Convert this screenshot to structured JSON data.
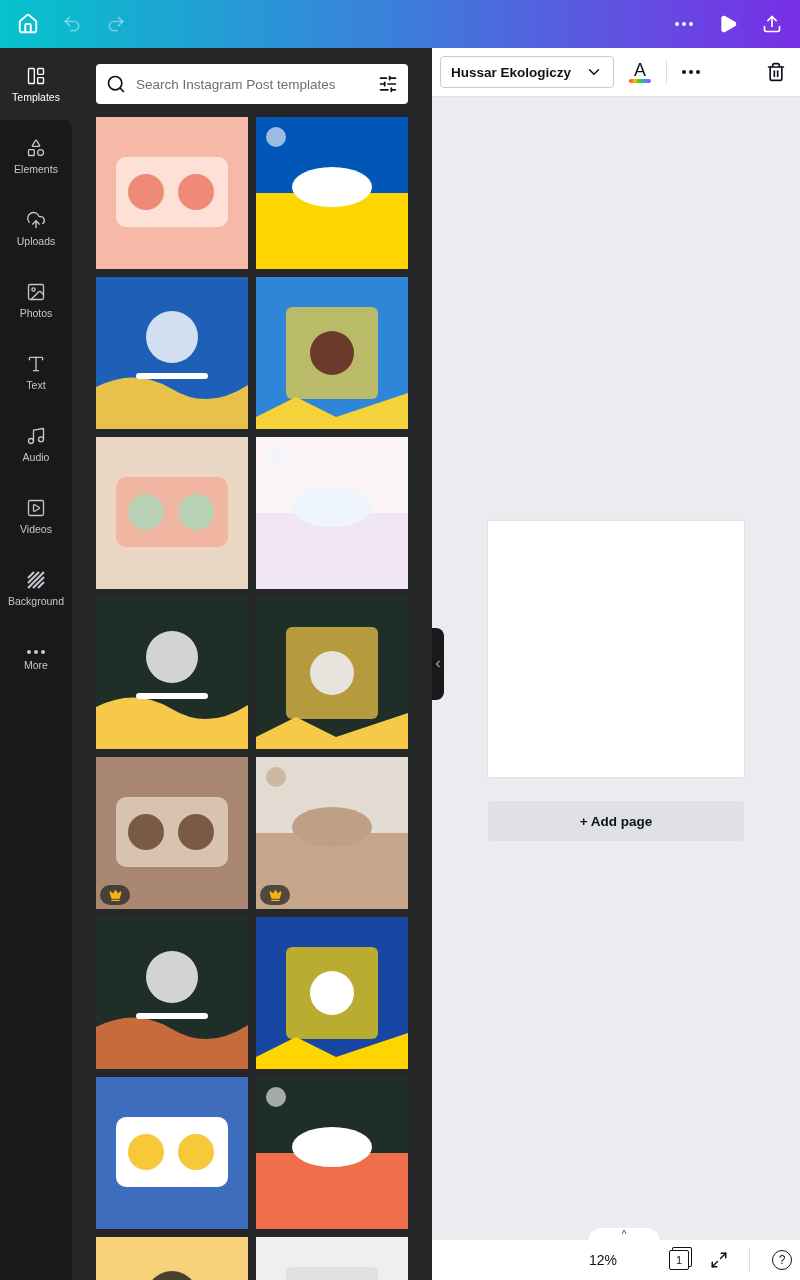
{
  "top_bar": {
    "undo_disabled": true,
    "redo_disabled": true
  },
  "sidebar": {
    "items": [
      {
        "label": "Templates",
        "kind": "templates",
        "selected": true
      },
      {
        "label": "Elements",
        "kind": "elements",
        "selected": false
      },
      {
        "label": "Uploads",
        "kind": "uploads",
        "selected": false
      },
      {
        "label": "Photos",
        "kind": "photos",
        "selected": false
      },
      {
        "label": "Text",
        "kind": "text",
        "selected": false
      },
      {
        "label": "Audio",
        "kind": "audio",
        "selected": false
      },
      {
        "label": "Videos",
        "kind": "videos",
        "selected": false
      },
      {
        "label": "Background",
        "kind": "background",
        "selected": false
      },
      {
        "label": "More",
        "kind": "more",
        "selected": false
      }
    ]
  },
  "search": {
    "placeholder": "Search Instagram Post templates"
  },
  "templates": [
    {
      "kind": "picture",
      "premium": false
    },
    {
      "kind": "picture",
      "premium": false
    },
    {
      "kind": "picture",
      "premium": false
    },
    {
      "kind": "picture",
      "premium": false
    },
    {
      "kind": "picture",
      "premium": false
    },
    {
      "kind": "picture",
      "premium": false
    },
    {
      "kind": "picture",
      "premium": false
    },
    {
      "kind": "picture",
      "premium": false
    },
    {
      "kind": "picture",
      "premium": true
    },
    {
      "kind": "picture",
      "premium": true
    },
    {
      "kind": "picture",
      "premium": false
    },
    {
      "kind": "picture",
      "premium": false
    },
    {
      "kind": "picture",
      "premium": false
    },
    {
      "kind": "picture",
      "premium": false
    },
    {
      "kind": "picture"
    },
    {
      "kind": "picture"
    }
  ],
  "toolbar": {
    "font": "Hussar Ekologiczy",
    "text_color_glyph": "A"
  },
  "canvas": {
    "add_page": "+ Add page"
  },
  "footer": {
    "zoom": "12%",
    "page_count": "1",
    "help": "?",
    "toggle": "^"
  }
}
